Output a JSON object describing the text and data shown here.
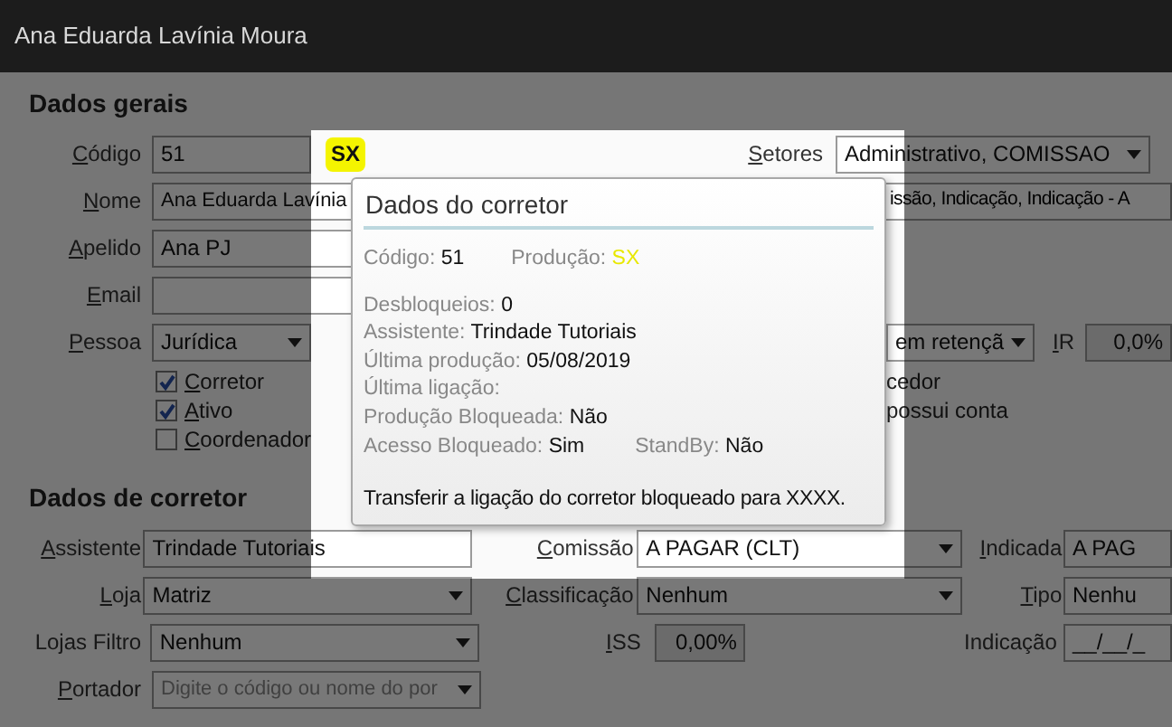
{
  "window": {
    "title": "Ana Eduarda Lavínia Moura"
  },
  "dados_gerais": {
    "heading": "Dados gerais",
    "codigo": {
      "label": {
        "text": "Código",
        "access_key": true
      },
      "value": "51",
      "badge": "SX"
    },
    "setores": {
      "label": {
        "text": "Setores",
        "access_key": true
      },
      "value": "Administrativo, COMISSAO"
    },
    "nome": {
      "label": {
        "text": "Nome",
        "access_key": true
      },
      "value": "Ana Eduarda Lavínia"
    },
    "nome_right_field": {
      "value": "issão, Indicação, Indicação - A"
    },
    "apelido": {
      "label": {
        "text": "Apelido",
        "access_key": true
      },
      "value": "Ana PJ"
    },
    "email": {
      "label": {
        "text": "Email",
        "access_key": true
      }
    },
    "pessoa": {
      "label": {
        "text": "Pessoa",
        "access_key": true
      },
      "value": "Jurídica"
    },
    "retencao": {
      "value": "em retençã"
    },
    "ir": {
      "label": {
        "text": "IR",
        "access_key": true
      },
      "value": "0,0%"
    },
    "checkboxes": [
      {
        "label": "Corretor",
        "checked": true
      },
      {
        "label": "Ativo",
        "checked": true
      },
      {
        "label": "Coordenador",
        "checked": false
      }
    ],
    "right_texts": [
      "cedor",
      "possui conta"
    ]
  },
  "dados_corretor": {
    "heading": "Dados de corretor",
    "rows": [
      {
        "left": {
          "label": {
            "text": "Assistente",
            "access_key": true
          },
          "value": "Trindade Tutoriais",
          "kind": "text"
        },
        "mid": {
          "label": {
            "text": "Comissão",
            "access_key": true
          },
          "value": "A PAGAR (CLT)",
          "kind": "combo"
        },
        "right": {
          "label": {
            "text": "Indicada",
            "access_key": true
          },
          "value": "A PAG",
          "kind": "text"
        }
      },
      {
        "left": {
          "label": {
            "text": "Loja",
            "access_key": true
          },
          "value": "Matriz",
          "kind": "combo"
        },
        "mid": {
          "label": {
            "text": "Classificação",
            "access_key": true
          },
          "value": "Nenhum",
          "kind": "combo"
        },
        "right": {
          "label": {
            "text": "Tipo",
            "access_key": true
          },
          "value": "Nenhu",
          "kind": "text"
        }
      },
      {
        "left": {
          "label": {
            "text": "Lojas Filtro",
            "access_key": false
          },
          "value": "Nenhum",
          "kind": "combo"
        },
        "mid": {
          "label": {
            "text": "ISS",
            "access_key": true
          },
          "value": "0,00%",
          "kind": "readonly"
        },
        "right": {
          "label": {
            "text": "Indicação",
            "access_key": false
          },
          "value": "__/__/_",
          "kind": "text"
        }
      },
      {
        "left": {
          "label": {
            "text": "Portador",
            "access_key": true
          },
          "placeholder": "Digite o código ou nome do por",
          "kind": "combo"
        }
      }
    ]
  },
  "popup": {
    "title": "Dados do corretor",
    "codigo": {
      "label": "Código:",
      "value": "51"
    },
    "producao": {
      "label": "Produção:",
      "value": "SX"
    },
    "lines": [
      {
        "label": "Desbloqueios:",
        "value": "0"
      },
      {
        "label": "Assistente:",
        "value": "Trindade Tutoriais"
      },
      {
        "label": "Última produção:",
        "value": "05/08/2019"
      },
      {
        "label": "Última ligação:"
      },
      {
        "label": "Produção Bloqueada:",
        "value": "Não"
      }
    ],
    "acesso": {
      "label": "Acesso Bloqueado:",
      "value": "Sim"
    },
    "standby": {
      "label": "StandBy:",
      "value": "Não"
    },
    "message": "Transferir a ligação do corretor bloqueado para XXXX."
  }
}
